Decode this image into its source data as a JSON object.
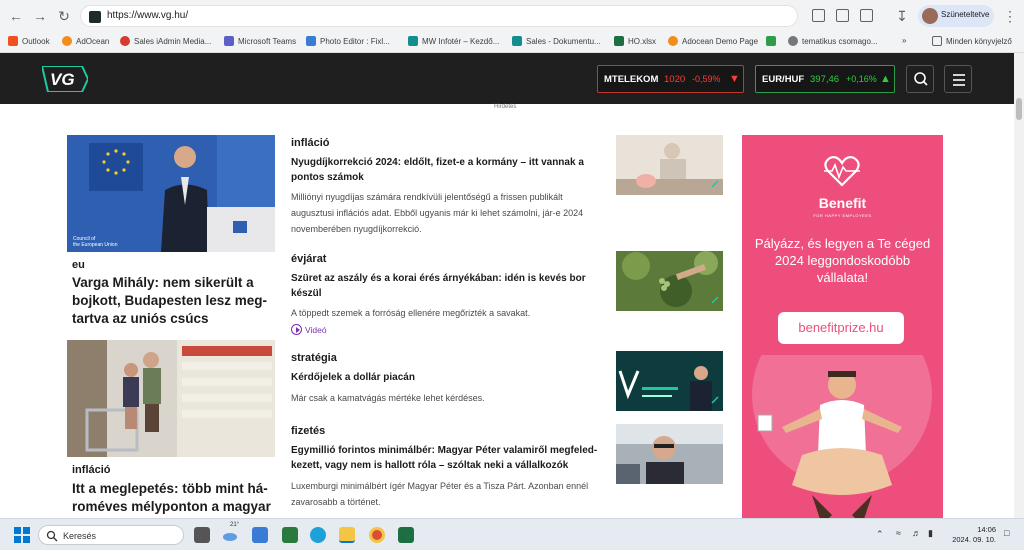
{
  "browser": {
    "url": "https://www.vg.hu/",
    "profile_label": "Szüneteltetve",
    "bookmarks": [
      "Outlook",
      "AdOcean",
      "Sales iAdmin Media...",
      "Microsoft Teams",
      "Photo Editor : Fixl...",
      "MW Infotér – Kezdő...",
      "Sales - Dokumentu...",
      "HO.xlsx",
      "Adocean Demo Page",
      "",
      "tematikus csomago...",
      "»",
      "Minden könyvjelző"
    ]
  },
  "header": {
    "logo": "VG",
    "tickers": [
      {
        "name": "MTELEKOM",
        "value": "1020",
        "change": "-0,59%",
        "direction": "down"
      },
      {
        "name": "EUR/HUF",
        "value": "397,46",
        "change": "+0,16%",
        "direction": "up"
      }
    ],
    "ad_label": "Hirdetés"
  },
  "left_articles": [
    {
      "category": "eu",
      "title": "Varga Mihály: nem sikerült a bojkott, Budapesten lesz meg-tartva az uniós csúcs"
    },
    {
      "category": "infláció",
      "title": "Itt a meglepetés: több mint há-roméves mélyponton a magyar"
    }
  ],
  "middle_articles": [
    {
      "category": "infláció",
      "title": "Nyugdíjkorrekció 2024: eldőlt, fizet-e a kormány – itt vannak a pontos számok",
      "lead": "Milliónyi nyugdíjas számára rendkívüli jelentőségű a frissen publikált augusztusi inflációs adat. Ebből ugyanis már ki lehet számolni, jár-e 2024 novemberében nyugdíjkorrekció."
    },
    {
      "category": "évjárat",
      "title": "Szüret az aszály és a korai érés árnyékában: idén is kevés bor készül",
      "lead": "A töppedt szemek a forróság ellenére megőrizték a savakat.",
      "video": "Videó"
    },
    {
      "category": "stratégia",
      "title": "Kérdőjelek a dollár piacán",
      "lead": "Már csak a kamatvágás mértéke lehet kérdéses."
    },
    {
      "category": "fizetés",
      "title": "Egymillió forintos minimálbér: Magyar Péter valamiről megfeled-kezett, vagy nem is hallott róla – szóltak neki a vállalkozók",
      "lead": "Luxemburgi minimálbért ígér Magyar Péter és a Tisza Párt. Azonban ennél zavarosabb a történet."
    }
  ],
  "ad": {
    "brand": "Benefit",
    "tagline": "FOR HAPPY EMPLOYEES",
    "headline": "Pályázz, és legyen a Te céged 2024 leggondoskodóbb vállalata!",
    "cta": "benefitprize.hu"
  },
  "taskbar": {
    "search_placeholder": "Keresés",
    "weather": "21°",
    "time": "14:06",
    "date": "2024. 09. 10."
  },
  "colors": {
    "accent": "#1ec8a0",
    "down": "#ff3b3b",
    "up": "#2ecc40",
    "ad_bg": "#ee4e7b"
  }
}
